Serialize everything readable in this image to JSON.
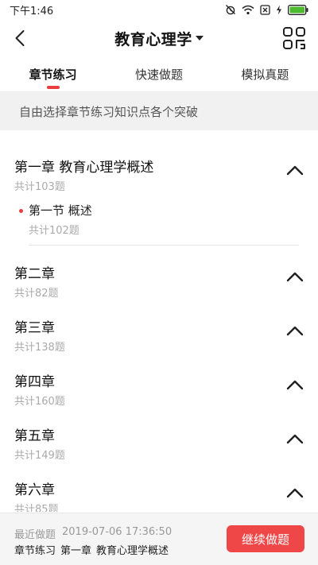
{
  "status_bar": {
    "time": "下午1:46",
    "icons": [
      "alarm-icon",
      "wifi-icon",
      "sim-icon",
      "charging-icon",
      "battery-icon"
    ]
  },
  "header": {
    "title": "教育心理学",
    "icons": {
      "back": "chevron-left-icon",
      "dropdown": "caret-down-icon",
      "grid": "grid-menu-icon"
    }
  },
  "tabs": [
    {
      "label": "章节练习",
      "active": true
    },
    {
      "label": "快速做题",
      "active": false
    },
    {
      "label": "模拟真题",
      "active": false
    }
  ],
  "hint": "自由选择章节练习知识点各个突破",
  "chapters": [
    {
      "title": "第一章  教育心理学概述",
      "count": "共计103题",
      "expanded": true,
      "sections": [
        {
          "title": "第一节 概述",
          "count": "共计102题"
        }
      ]
    },
    {
      "title": "第二章",
      "count": "共计82题",
      "expanded": false
    },
    {
      "title": "第三章",
      "count": "共计138题",
      "expanded": false
    },
    {
      "title": "第四章",
      "count": "共计160题",
      "expanded": false
    },
    {
      "title": "第五章",
      "count": "共计149题",
      "expanded": false
    },
    {
      "title": "第六章",
      "count": "共计85题",
      "expanded": false
    }
  ],
  "bottom": {
    "recent_label": "最近做题",
    "recent_time": "2019-07-06 17:36:50",
    "recent_tab": "章节练习",
    "recent_chapter": "第一章",
    "recent_chapter_title": "教育心理学概述",
    "continue_label": "继续做题"
  },
  "colors": {
    "accent": "#ea3d3d",
    "button": "#ef4747"
  }
}
